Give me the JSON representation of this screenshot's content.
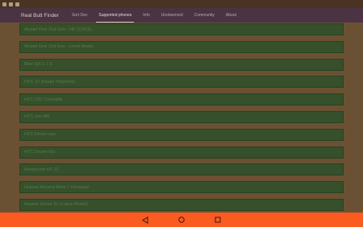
{
  "app": {
    "title": "Real Butt Finder",
    "tabs": [
      {
        "label": "Sort Dev"
      },
      {
        "label": "Supported phones"
      },
      {
        "label": "Info"
      },
      {
        "label": "Unobserved"
      },
      {
        "label": "Community"
      },
      {
        "label": "About"
      }
    ]
  },
  "devices": [
    {
      "name": "Alcatel One 2nd Gen - HD (CN19)"
    },
    {
      "name": "Alcatel One 2nd Gen - Level Model"
    },
    {
      "name": "Blue Sth 1 1 5"
    },
    {
      "name": "HTC 10 (model m9pmuhl)"
    },
    {
      "name": "HTC U11 Concepts"
    },
    {
      "name": "HTC one M8"
    },
    {
      "name": "HTC Desire eye"
    },
    {
      "name": "HTC Desire 6xx"
    },
    {
      "name": "Honeycom HT 12"
    },
    {
      "name": "Huawei Ascend Mate 7 Honypod"
    },
    {
      "name": "Huawei Honor 6x (Lupus Model)"
    }
  ],
  "colors": {
    "list_item_bg": "#35502a",
    "app_bar_bg": "#4a3443",
    "nav_bar_bg": "#fb5a21",
    "page_bg": "#6b5133"
  },
  "system": {
    "status_icons": [
      "notification-icon",
      "notification-icon",
      "notification-icon"
    ],
    "nav_icons": [
      "back-icon",
      "home-icon",
      "recents-icon"
    ]
  }
}
